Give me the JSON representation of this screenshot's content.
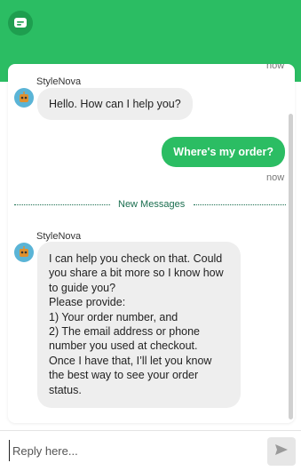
{
  "header": {
    "logo_icon": "chat-bubble-icon",
    "color": "#2bbd63"
  },
  "messages": {
    "prev_time": "now",
    "greeting": {
      "sender": "StyleNova",
      "text": "Hello. How can I help you?"
    },
    "user": {
      "text": "Where's my order?",
      "time": "now"
    },
    "divider": "New Messages",
    "reply": {
      "sender": "StyleNova",
      "lines": [
        "I can help you check on that. Could",
        "you share a bit more so I know how",
        "to guide you?",
        "Please provide:",
        "1) Your order number, and",
        "2) The email address or phone",
        "number you used at checkout.",
        "Once I have that, I’ll let you know",
        "the best way to see your order",
        "status."
      ]
    }
  },
  "composer": {
    "placeholder": "Reply here...",
    "send_icon": "send-icon"
  }
}
